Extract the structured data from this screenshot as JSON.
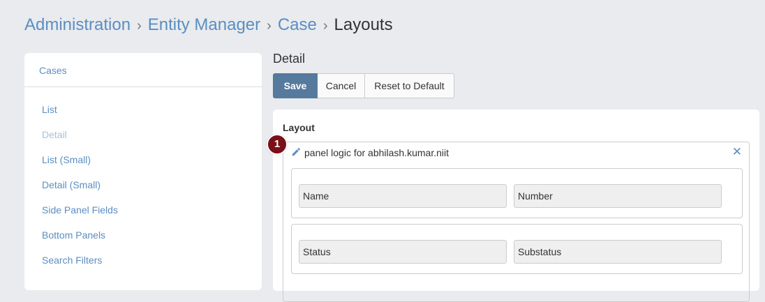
{
  "breadcrumb": {
    "items": [
      "Administration",
      "Entity Manager",
      "Case"
    ],
    "current": "Layouts",
    "separator": "›"
  },
  "sidebar": {
    "header": "Cases",
    "items": [
      {
        "label": "List",
        "disabled": false
      },
      {
        "label": "Detail",
        "disabled": true
      },
      {
        "label": "List (Small)",
        "disabled": false
      },
      {
        "label": "Detail (Small)",
        "disabled": false
      },
      {
        "label": "Side Panel Fields",
        "disabled": false
      },
      {
        "label": "Bottom Panels",
        "disabled": false
      },
      {
        "label": "Search Filters",
        "disabled": false
      }
    ]
  },
  "main": {
    "title": "Detail",
    "buttons": {
      "save": "Save",
      "cancel": "Cancel",
      "reset": "Reset to Default"
    },
    "layout_label": "Layout",
    "panel": {
      "badge": "1",
      "title": "panel logic for abhilash.kumar.niit",
      "close": "✕",
      "rows": [
        [
          "Name",
          "Number"
        ],
        [
          "Status",
          "Substatus"
        ]
      ]
    }
  },
  "colors": {
    "link": "#5b8ec1",
    "primary_button": "#567a9d",
    "badge": "#7a1018",
    "background": "#e9ebee"
  }
}
